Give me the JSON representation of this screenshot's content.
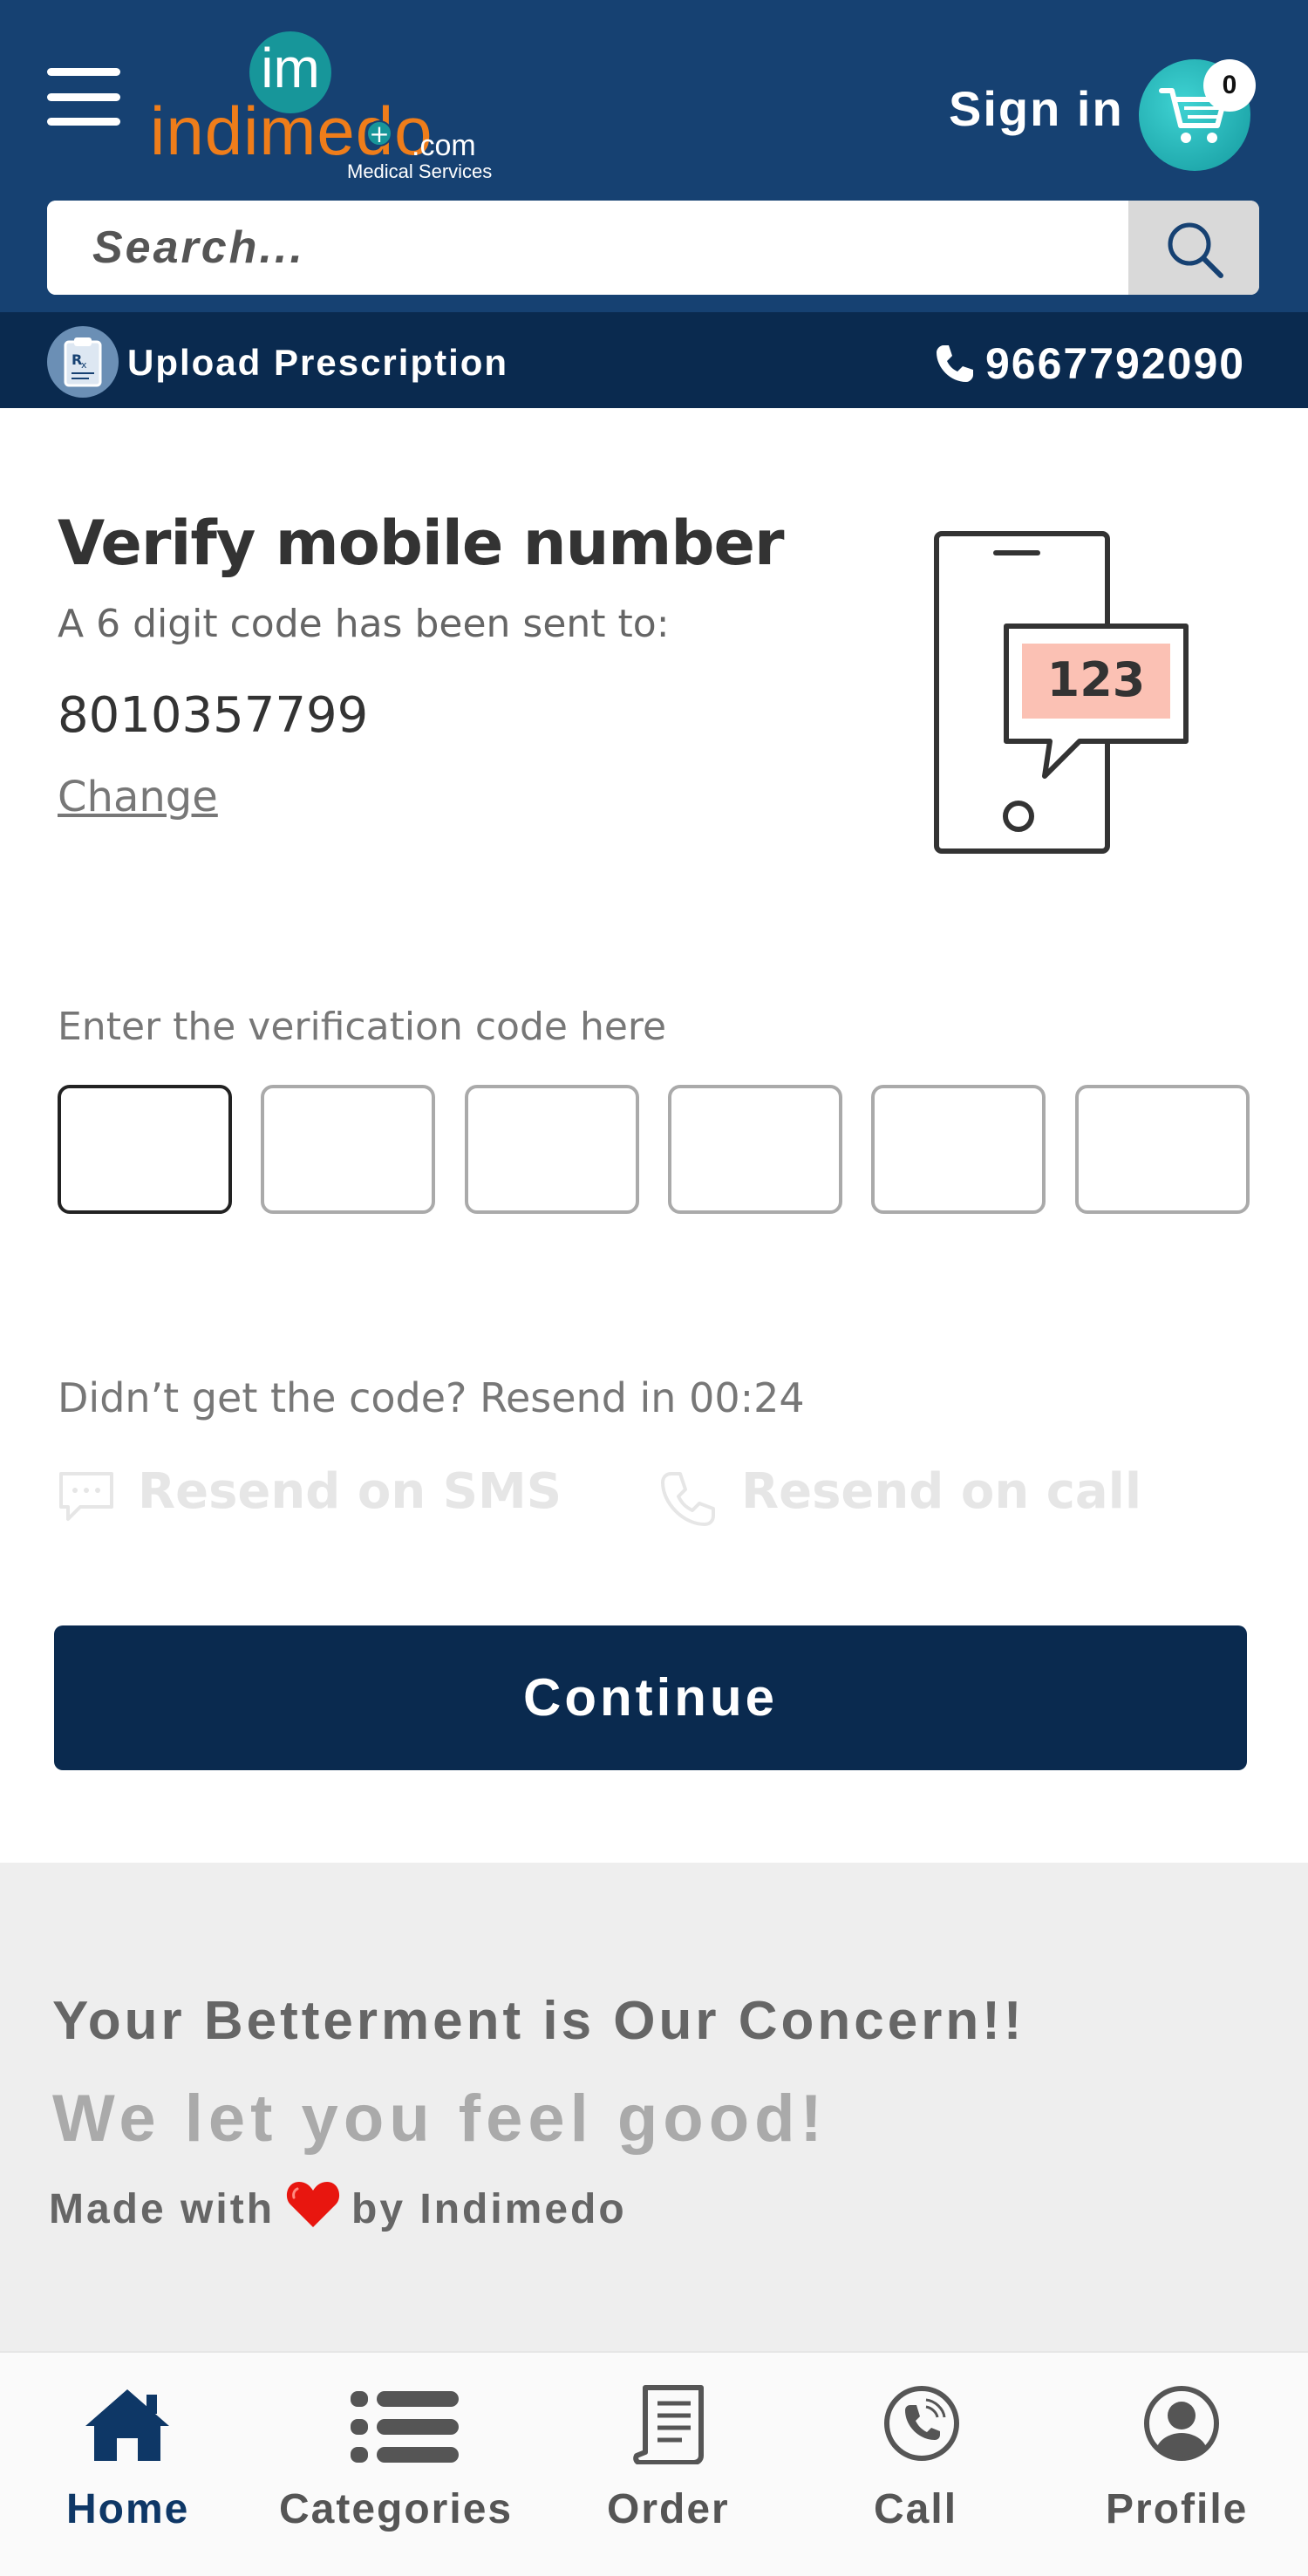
{
  "header": {
    "logo": {
      "monogram": "im",
      "wordmark": "indimedo",
      "tld": ".com",
      "tagline": "Medical Services"
    },
    "sign_in_label": "Sign in",
    "cart_count": "0",
    "search": {
      "placeholder": "Search...",
      "value": ""
    },
    "upload_prescription_label": "Upload Prescription",
    "phone_number": "9667792090"
  },
  "verify": {
    "title": "Verify mobile number",
    "subtitle": "A 6 digit code has been sent to:",
    "mobile_number": "8010357799",
    "change_label": "Change",
    "illustration_code": "123",
    "code_label": "Enter the verification code here",
    "otp_digits": [
      "",
      "",
      "",
      "",
      "",
      ""
    ],
    "resend_timer_text": "Didn’t get the code? Resend in 00:24",
    "resend_sms_label": "Resend on SMS",
    "resend_call_label": "Resend on call",
    "continue_label": "Continue"
  },
  "footer": {
    "tagline_1": "Your Betterment is Our Concern!!",
    "tagline_2": "We let you feel good!",
    "made_with_prefix": "Made with",
    "made_with_suffix": "by Indimedo"
  },
  "bottom_nav": {
    "items": [
      {
        "label": "Home",
        "icon": "home-icon",
        "active": true
      },
      {
        "label": "Categories",
        "icon": "list-icon",
        "active": false
      },
      {
        "label": "Order",
        "icon": "receipt-icon",
        "active": false
      },
      {
        "label": "Call",
        "icon": "phone-circle-icon",
        "active": false
      },
      {
        "label": "Profile",
        "icon": "user-circle-icon",
        "active": false
      }
    ]
  },
  "colors": {
    "header_bg": "#164172",
    "subbar_bg": "#0a2a4f",
    "brand_orange": "#ef7d1a",
    "brand_teal": "#17969a",
    "continue_bg": "#0a2a4f",
    "illustration_bubble": "#fbc1b4"
  }
}
